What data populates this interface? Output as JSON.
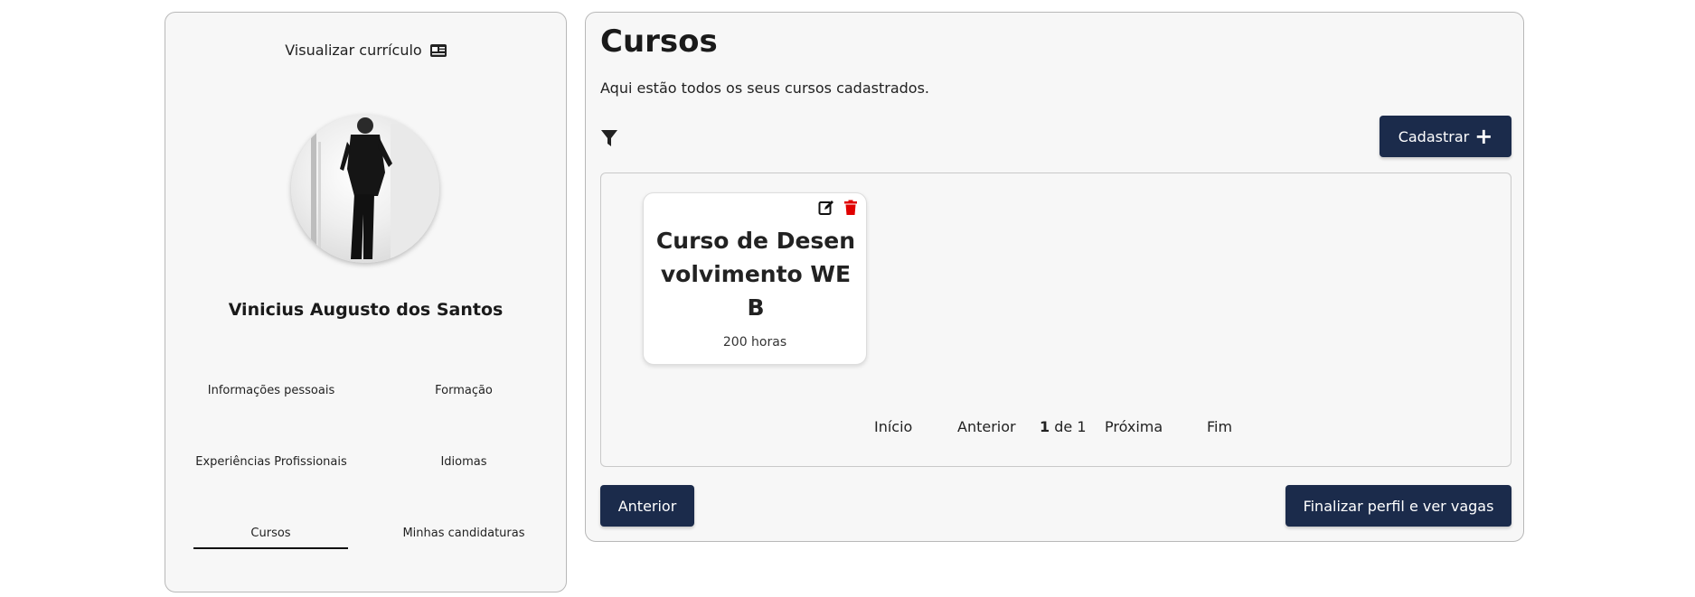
{
  "sidebar": {
    "view_cv_label": "Visualizar currículo",
    "user_name": "Vinicius Augusto dos Santos",
    "nav": [
      {
        "label": "Informações pessoais"
      },
      {
        "label": "Formação"
      },
      {
        "label": "Experiências Profissionais"
      },
      {
        "label": "Idiomas"
      },
      {
        "label": "Cursos",
        "active": true
      },
      {
        "label": "Minhas candidaturas"
      }
    ]
  },
  "main": {
    "title": "Cursos",
    "subtitle": "Aqui estão todos os seus cursos cadastrados.",
    "add_button_label": "Cadastrar",
    "courses": [
      {
        "title": "Curso de Desenvolvimento WEB",
        "hours": "200 horas"
      }
    ],
    "pagination": {
      "first": "Início",
      "prev": "Anterior",
      "current": "1",
      "separator": "de",
      "total": "1",
      "next": "Próxima",
      "last": "Fim"
    },
    "back_button_label": "Anterior",
    "finish_button_label": "Finalizar perfil e ver vagas"
  },
  "colors": {
    "primary_button": "#1b2b4b",
    "delete_icon": "#e00000",
    "panel_background": "#f7f7f7"
  },
  "icons": [
    "id-card-icon",
    "filter-icon",
    "plus-icon",
    "edit-icon",
    "trash-icon"
  ]
}
